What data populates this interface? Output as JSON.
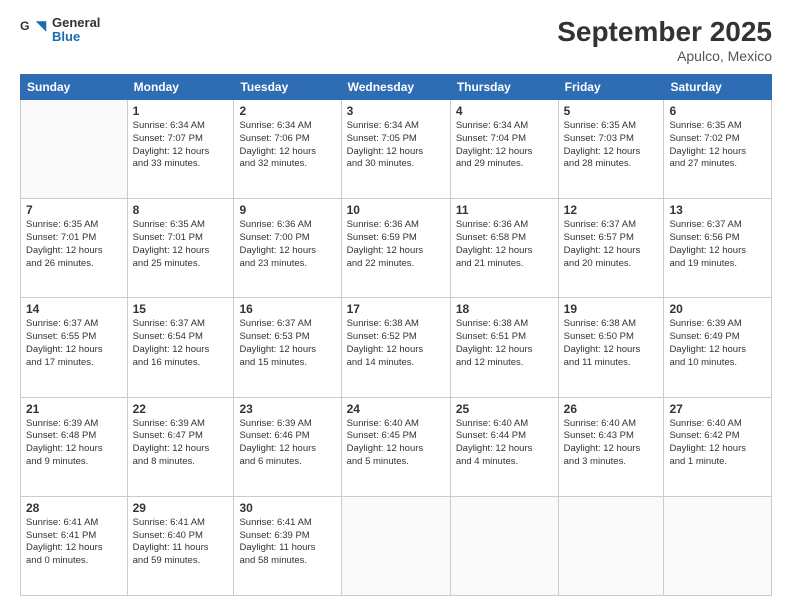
{
  "header": {
    "logo_general": "General",
    "logo_blue": "Blue",
    "month": "September 2025",
    "location": "Apulco, Mexico"
  },
  "days": [
    "Sunday",
    "Monday",
    "Tuesday",
    "Wednesday",
    "Thursday",
    "Friday",
    "Saturday"
  ],
  "weeks": [
    [
      {
        "date": "",
        "info": ""
      },
      {
        "date": "1",
        "info": "Sunrise: 6:34 AM\nSunset: 7:07 PM\nDaylight: 12 hours\nand 33 minutes."
      },
      {
        "date": "2",
        "info": "Sunrise: 6:34 AM\nSunset: 7:06 PM\nDaylight: 12 hours\nand 32 minutes."
      },
      {
        "date": "3",
        "info": "Sunrise: 6:34 AM\nSunset: 7:05 PM\nDaylight: 12 hours\nand 30 minutes."
      },
      {
        "date": "4",
        "info": "Sunrise: 6:34 AM\nSunset: 7:04 PM\nDaylight: 12 hours\nand 29 minutes."
      },
      {
        "date": "5",
        "info": "Sunrise: 6:35 AM\nSunset: 7:03 PM\nDaylight: 12 hours\nand 28 minutes."
      },
      {
        "date": "6",
        "info": "Sunrise: 6:35 AM\nSunset: 7:02 PM\nDaylight: 12 hours\nand 27 minutes."
      }
    ],
    [
      {
        "date": "7",
        "info": "Sunrise: 6:35 AM\nSunset: 7:01 PM\nDaylight: 12 hours\nand 26 minutes."
      },
      {
        "date": "8",
        "info": "Sunrise: 6:35 AM\nSunset: 7:01 PM\nDaylight: 12 hours\nand 25 minutes."
      },
      {
        "date": "9",
        "info": "Sunrise: 6:36 AM\nSunset: 7:00 PM\nDaylight: 12 hours\nand 23 minutes."
      },
      {
        "date": "10",
        "info": "Sunrise: 6:36 AM\nSunset: 6:59 PM\nDaylight: 12 hours\nand 22 minutes."
      },
      {
        "date": "11",
        "info": "Sunrise: 6:36 AM\nSunset: 6:58 PM\nDaylight: 12 hours\nand 21 minutes."
      },
      {
        "date": "12",
        "info": "Sunrise: 6:37 AM\nSunset: 6:57 PM\nDaylight: 12 hours\nand 20 minutes."
      },
      {
        "date": "13",
        "info": "Sunrise: 6:37 AM\nSunset: 6:56 PM\nDaylight: 12 hours\nand 19 minutes."
      }
    ],
    [
      {
        "date": "14",
        "info": "Sunrise: 6:37 AM\nSunset: 6:55 PM\nDaylight: 12 hours\nand 17 minutes."
      },
      {
        "date": "15",
        "info": "Sunrise: 6:37 AM\nSunset: 6:54 PM\nDaylight: 12 hours\nand 16 minutes."
      },
      {
        "date": "16",
        "info": "Sunrise: 6:37 AM\nSunset: 6:53 PM\nDaylight: 12 hours\nand 15 minutes."
      },
      {
        "date": "17",
        "info": "Sunrise: 6:38 AM\nSunset: 6:52 PM\nDaylight: 12 hours\nand 14 minutes."
      },
      {
        "date": "18",
        "info": "Sunrise: 6:38 AM\nSunset: 6:51 PM\nDaylight: 12 hours\nand 12 minutes."
      },
      {
        "date": "19",
        "info": "Sunrise: 6:38 AM\nSunset: 6:50 PM\nDaylight: 12 hours\nand 11 minutes."
      },
      {
        "date": "20",
        "info": "Sunrise: 6:39 AM\nSunset: 6:49 PM\nDaylight: 12 hours\nand 10 minutes."
      }
    ],
    [
      {
        "date": "21",
        "info": "Sunrise: 6:39 AM\nSunset: 6:48 PM\nDaylight: 12 hours\nand 9 minutes."
      },
      {
        "date": "22",
        "info": "Sunrise: 6:39 AM\nSunset: 6:47 PM\nDaylight: 12 hours\nand 8 minutes."
      },
      {
        "date": "23",
        "info": "Sunrise: 6:39 AM\nSunset: 6:46 PM\nDaylight: 12 hours\nand 6 minutes."
      },
      {
        "date": "24",
        "info": "Sunrise: 6:40 AM\nSunset: 6:45 PM\nDaylight: 12 hours\nand 5 minutes."
      },
      {
        "date": "25",
        "info": "Sunrise: 6:40 AM\nSunset: 6:44 PM\nDaylight: 12 hours\nand 4 minutes."
      },
      {
        "date": "26",
        "info": "Sunrise: 6:40 AM\nSunset: 6:43 PM\nDaylight: 12 hours\nand 3 minutes."
      },
      {
        "date": "27",
        "info": "Sunrise: 6:40 AM\nSunset: 6:42 PM\nDaylight: 12 hours\nand 1 minute."
      }
    ],
    [
      {
        "date": "28",
        "info": "Sunrise: 6:41 AM\nSunset: 6:41 PM\nDaylight: 12 hours\nand 0 minutes."
      },
      {
        "date": "29",
        "info": "Sunrise: 6:41 AM\nSunset: 6:40 PM\nDaylight: 11 hours\nand 59 minutes."
      },
      {
        "date": "30",
        "info": "Sunrise: 6:41 AM\nSunset: 6:39 PM\nDaylight: 11 hours\nand 58 minutes."
      },
      {
        "date": "",
        "info": ""
      },
      {
        "date": "",
        "info": ""
      },
      {
        "date": "",
        "info": ""
      },
      {
        "date": "",
        "info": ""
      }
    ]
  ]
}
